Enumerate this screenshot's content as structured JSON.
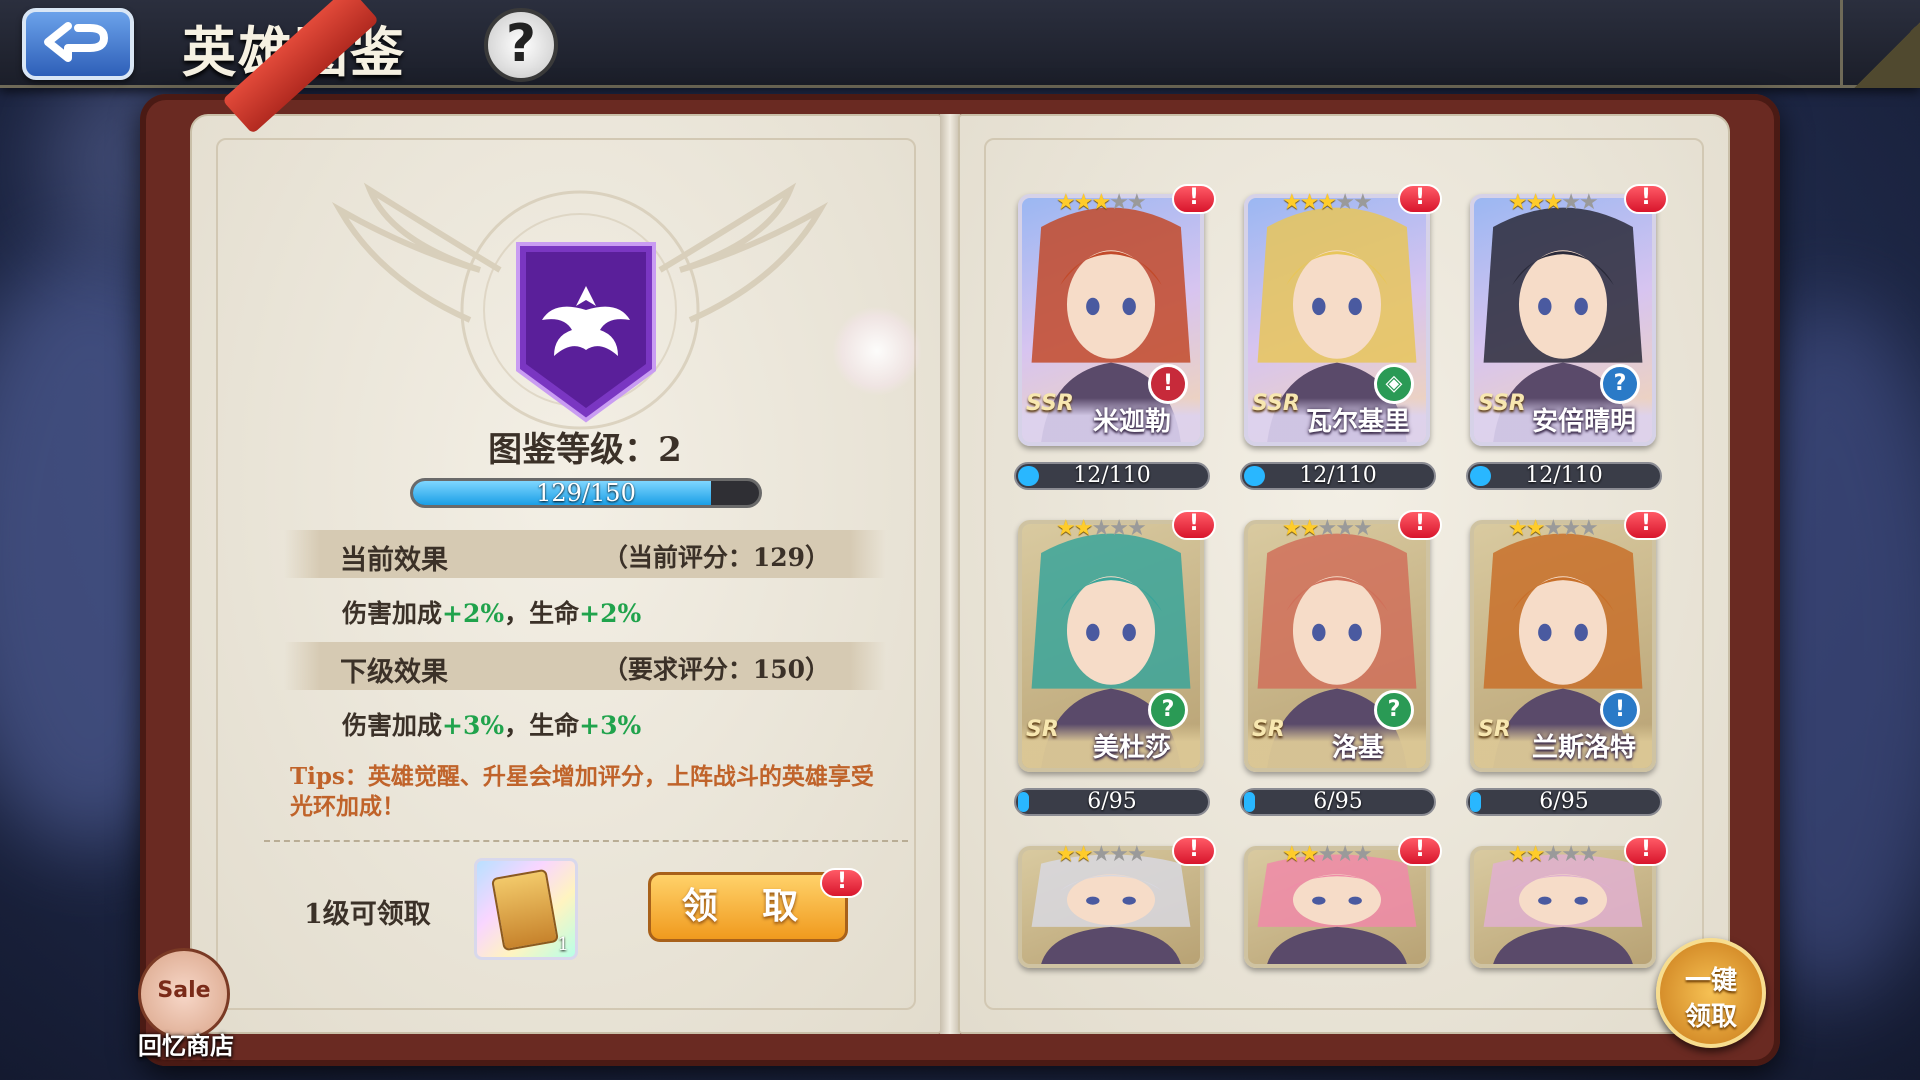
{
  "header": {
    "title": "英雄图鉴",
    "back_icon": "back-arrow-icon",
    "help_label": "?"
  },
  "album": {
    "level_text": "图鉴等级：2",
    "progress_text": "129/150",
    "progress_fraction": 0.86,
    "current_effect": {
      "label": "当前效果",
      "score_text": "（当前评分：129）",
      "damage_label": "伤害加成",
      "damage_value": "+2%",
      "sep": "，",
      "hp_label": "生命",
      "hp_value": "+2%"
    },
    "next_effect": {
      "label": "下级效果",
      "score_text": "（要求评分：150）",
      "damage_label": "伤害加成",
      "damage_value": "+3%",
      "sep": "，",
      "hp_label": "生命",
      "hp_value": "+3%"
    },
    "tips": "Tips：英雄觉醒、升星会增加评分，上阵战斗的英雄享受光环加成！",
    "reward": {
      "label": "1级可领取",
      "item_count": "1",
      "claim_label": "领 取",
      "badge": "!"
    }
  },
  "shop": {
    "sale_text": "Sale",
    "label": "回忆商店"
  },
  "heroes": [
    {
      "name": "米迦勒",
      "rarity": "SSR",
      "stars": 3,
      "max_stars": 5,
      "progress": "12/110",
      "fraction": 0.11,
      "class_icon": "sword-icon",
      "class_glyph": "!",
      "class_color": "#c72a3a",
      "badge": "!"
    },
    {
      "name": "瓦尔基里",
      "rarity": "SSR",
      "stars": 3,
      "max_stars": 5,
      "progress": "12/110",
      "fraction": 0.11,
      "class_icon": "shield-icon",
      "class_glyph": "◈",
      "class_color": "#2a9a55",
      "badge": "!"
    },
    {
      "name": "安倍晴明",
      "rarity": "SSR",
      "stars": 3,
      "max_stars": 5,
      "progress": "12/110",
      "fraction": 0.11,
      "class_icon": "mage-icon",
      "class_glyph": "?",
      "class_color": "#2a7ac7",
      "badge": "!"
    },
    {
      "name": "美杜莎",
      "rarity": "SR",
      "stars": 2,
      "max_stars": 5,
      "progress": "6/95",
      "fraction": 0.06,
      "class_icon": "support-icon",
      "class_glyph": "?",
      "class_color": "#2a9a55",
      "badge": "!"
    },
    {
      "name": "洛基",
      "rarity": "SR",
      "stars": 2,
      "max_stars": 5,
      "progress": "6/95",
      "fraction": 0.06,
      "class_icon": "support-icon",
      "class_glyph": "?",
      "class_color": "#2a9a55",
      "badge": "!"
    },
    {
      "name": "兰斯洛特",
      "rarity": "SR",
      "stars": 2,
      "max_stars": 5,
      "progress": "6/95",
      "fraction": 0.06,
      "class_icon": "sword-icon",
      "class_glyph": "!",
      "class_color": "#2a7ac7",
      "badge": "!"
    },
    {
      "stars": 2,
      "max_stars": 5,
      "badge": "!"
    },
    {
      "stars": 2,
      "max_stars": 5,
      "badge": "!"
    },
    {
      "stars": 2,
      "max_stars": 5,
      "badge": "!"
    }
  ],
  "one_key": {
    "line1": "一键",
    "line2": "领取"
  }
}
